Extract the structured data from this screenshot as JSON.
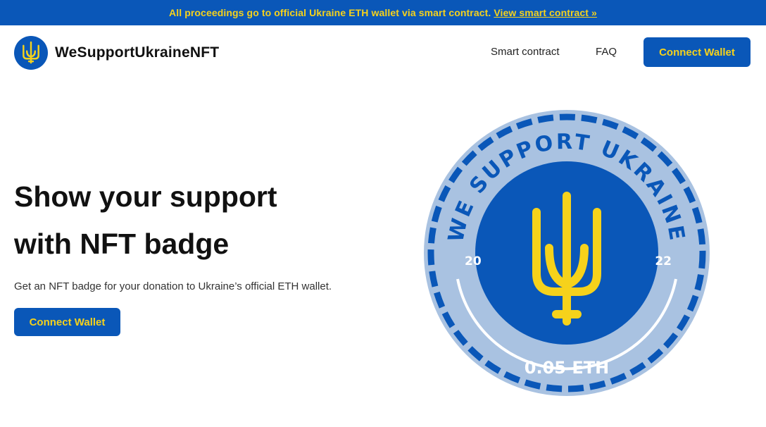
{
  "announcement": {
    "text": "All proceedings go to official Ukraine ETH wallet via smart contract.",
    "link_label": "View smart contract »"
  },
  "header": {
    "logo_text": "WeSupportUkraineNFT",
    "logo_icon": "trident-icon",
    "nav": [
      {
        "label": "Smart contract"
      },
      {
        "label": "FAQ"
      }
    ],
    "connect_label": "Connect Wallet"
  },
  "hero": {
    "title_line1": "Show your support",
    "title_line2": "with NFT badge",
    "subtitle": "Get an NFT badge for your donation to Ukraine’s official ETH wallet.",
    "cta_label": "Connect Wallet"
  },
  "badge": {
    "arc_text": "WE SUPPORT UKRAINE",
    "year_left": "20",
    "year_right": "22",
    "price": "0.05 ETH",
    "icon": "trident-icon"
  },
  "colors": {
    "brand_blue": "#0a57b8",
    "brand_yellow": "#f6d21b",
    "badge_outer": "#a9c2e1"
  }
}
